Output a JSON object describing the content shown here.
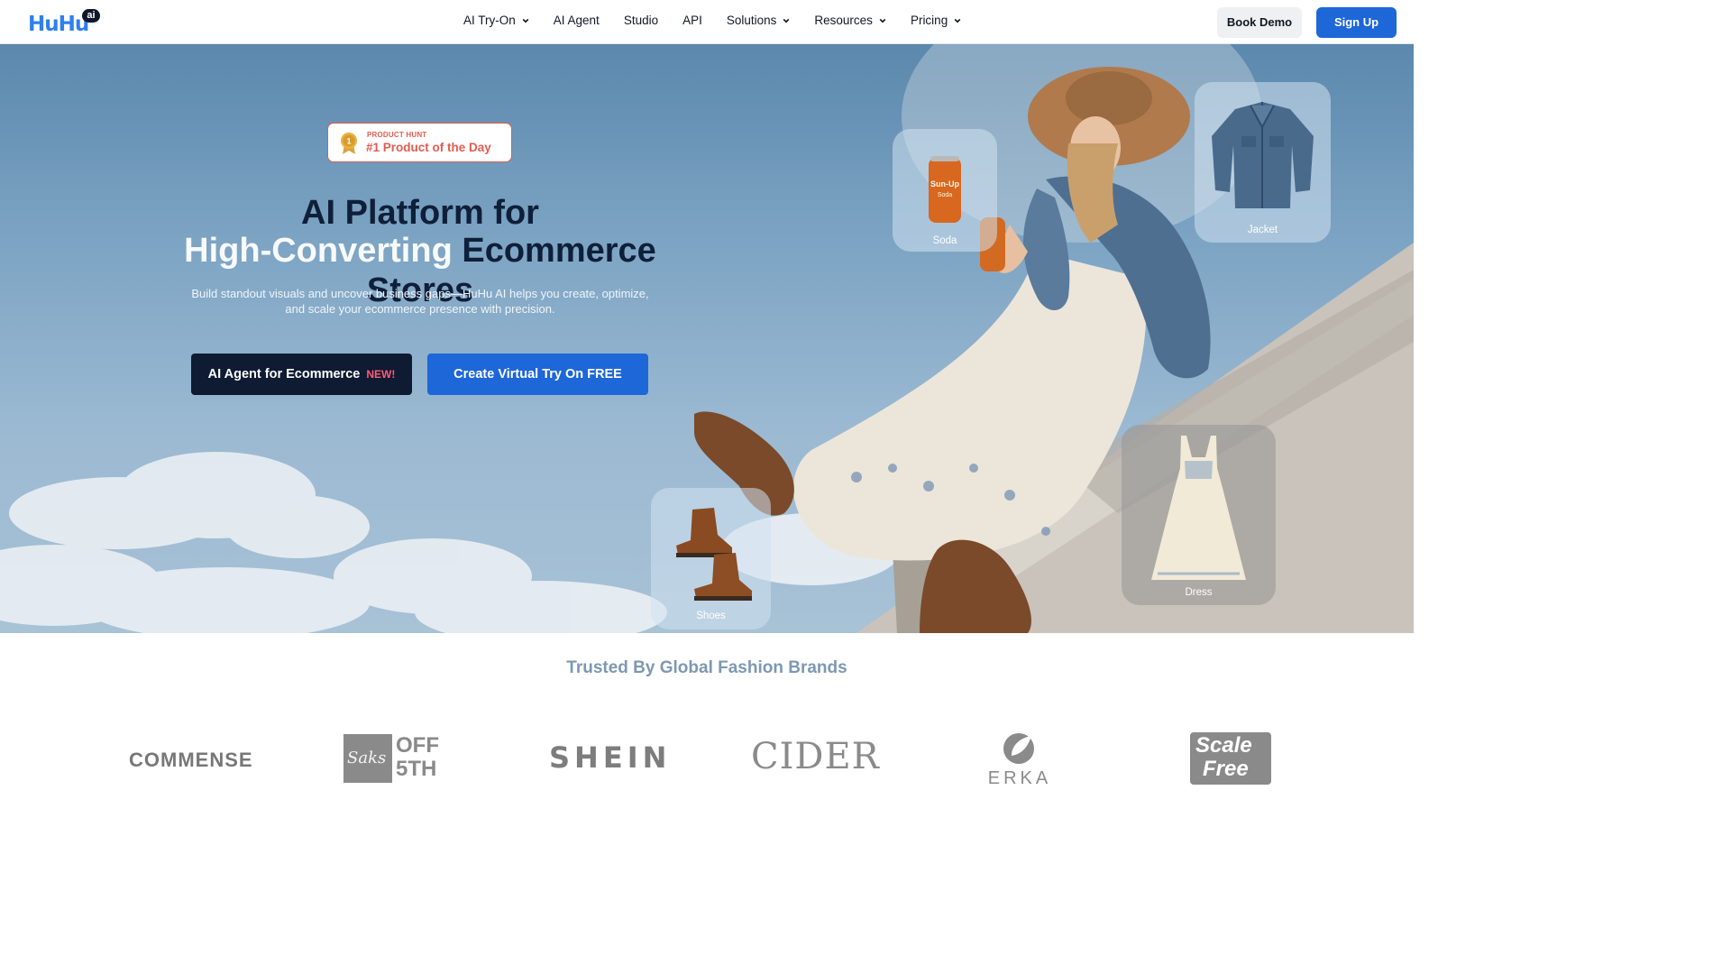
{
  "nav": {
    "logo_text": "HuHu",
    "logo_badge": "ai",
    "menu": [
      {
        "label": "AI Try-On",
        "dropdown": true
      },
      {
        "label": "AI Agent",
        "dropdown": false
      },
      {
        "label": "Studio",
        "dropdown": false
      },
      {
        "label": "API",
        "dropdown": false
      },
      {
        "label": "Solutions",
        "dropdown": true
      },
      {
        "label": "Resources",
        "dropdown": true
      },
      {
        "label": "Pricing",
        "dropdown": true
      }
    ],
    "book_demo": "Book Demo",
    "sign_up": "Sign Up"
  },
  "hero": {
    "badge_small": "PRODUCT HUNT",
    "badge_big": "#1 Product of the Day",
    "headline_line1": "AI Platform for",
    "headline_line2_white": "High-Converting",
    "headline_line2_dark": "Ecommerce Stores",
    "subtitle_line1": "Build standout visuals and uncover business gaps—HuHu AI helps you create, optimize,",
    "subtitle_line2": "and scale your ecommerce presence with precision.",
    "cta_agent": "AI Agent for Ecommerce",
    "cta_agent_tag": "NEW!",
    "cta_tryon": "Create Virtual Try On FREE",
    "cards": {
      "soda": "Soda",
      "soda_can_text": "Sun-Up",
      "soda_can_sub": "Soda",
      "jacket": "Jacket",
      "shoes": "Shoes",
      "dress": "Dress"
    }
  },
  "brands": {
    "heading": "Trusted By Global Fashion Brands",
    "logos": {
      "commense": "COMMENSE",
      "saks_script": "Saks",
      "saks_off": "OFF",
      "saks_5th": "5TH",
      "shein": "SHEIN",
      "cider": "CIDER",
      "erka": "ERKA",
      "scale": "Scale",
      "free": "Free"
    }
  },
  "colors": {
    "primary": "#1d67d8",
    "dark": "#0f1a33",
    "accent_red": "#e15b4f",
    "new_tag": "#ff5c73"
  }
}
